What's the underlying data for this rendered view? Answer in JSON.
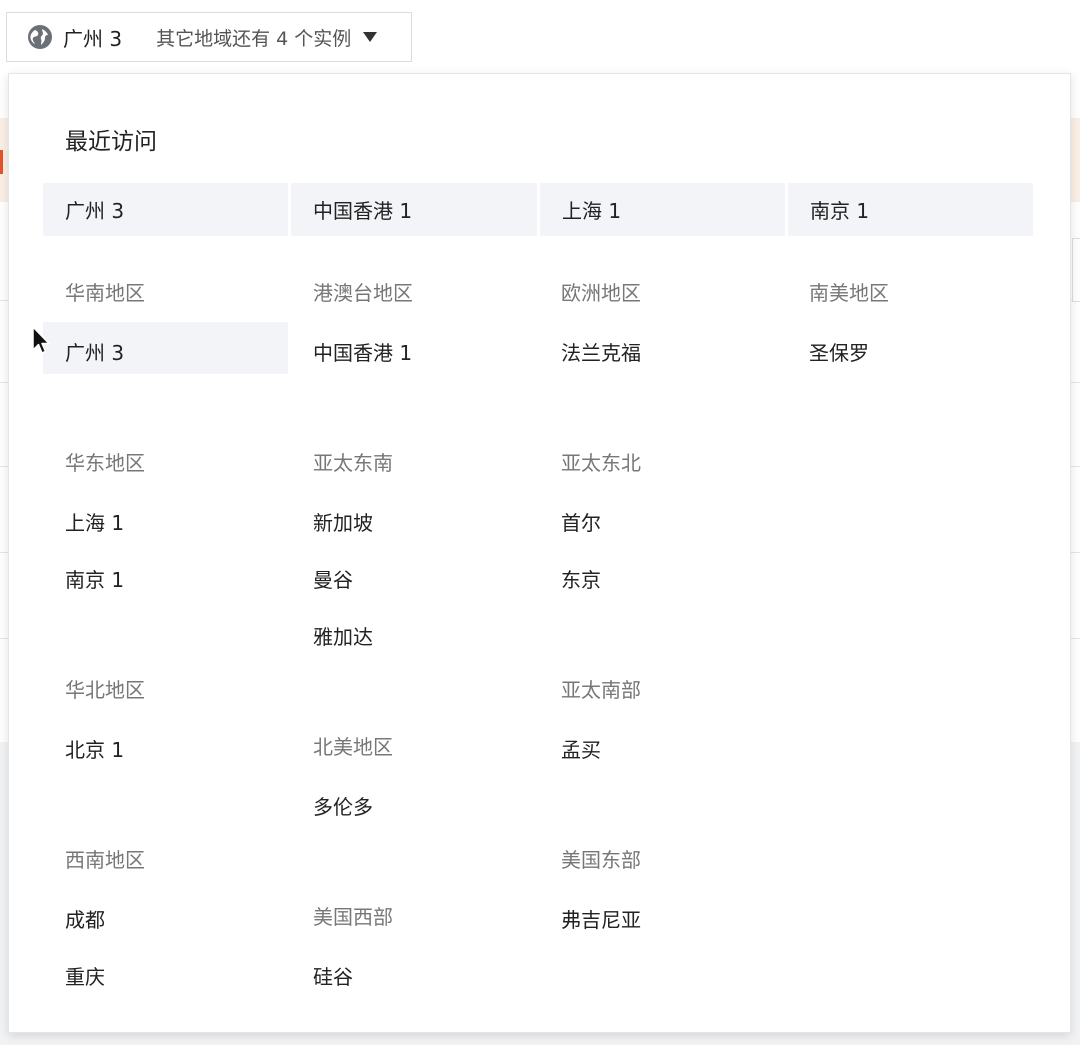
{
  "selector": {
    "current_region": "广州 3",
    "other_regions_text": "其它地域还有 4 个实例",
    "icon": "globe-icon",
    "caret_icon": "caret-down-icon"
  },
  "recent": {
    "title": "最近访问",
    "items": [
      "广州 3",
      "中国香港 1",
      "上海 1",
      "南京 1"
    ]
  },
  "regions": {
    "south_china": {
      "title": "华南地区",
      "cities": [
        "广州 3"
      ]
    },
    "hk_macau_tw": {
      "title": "港澳台地区",
      "cities": [
        "中国香港 1"
      ]
    },
    "europe": {
      "title": "欧洲地区",
      "cities": [
        "法兰克福"
      ]
    },
    "south_america": {
      "title": "南美地区",
      "cities": [
        "圣保罗"
      ]
    },
    "east_china": {
      "title": "华东地区",
      "cities": [
        "上海 1",
        "南京 1"
      ]
    },
    "asia_pacific_southeast": {
      "title": "亚太东南",
      "cities": [
        "新加坡",
        "曼谷",
        "雅加达"
      ]
    },
    "asia_pacific_northeast": {
      "title": "亚太东北",
      "cities": [
        "首尔",
        "东京"
      ]
    },
    "north_china": {
      "title": "华北地区",
      "cities": [
        "北京 1"
      ]
    },
    "north_america": {
      "title": "北美地区",
      "cities": [
        "多伦多"
      ]
    },
    "asia_pacific_south": {
      "title": "亚太南部",
      "cities": [
        "孟买"
      ]
    },
    "southwest_china": {
      "title": "西南地区",
      "cities": [
        "成都",
        "重庆"
      ]
    },
    "us_west": {
      "title": "美国西部",
      "cities": [
        "硅谷"
      ]
    },
    "us_east": {
      "title": "美国东部",
      "cities": [
        "弗吉尼亚"
      ]
    }
  },
  "colors": {
    "highlight_bg": "#f2f4f7",
    "heading_text": "#777777",
    "item_text": "#222222",
    "panel_bg": "#ffffff"
  }
}
